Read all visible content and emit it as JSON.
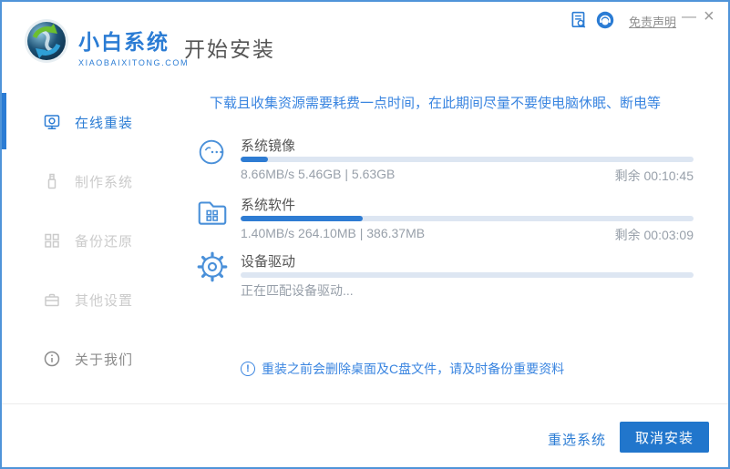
{
  "titlebar": {
    "brand": "小白系统",
    "brand_sub": "XIAOBAIXITONG.COM",
    "page_title": "开始安装",
    "disclaimer_label": "免责声明",
    "minimize_glyph": "—",
    "close_glyph": "×",
    "report_icon": "document-search-icon",
    "service_icon": "customer-service-icon"
  },
  "sidebar": {
    "items": [
      {
        "label": "在线重装",
        "icon": "online-reinstall-icon",
        "active": true
      },
      {
        "label": "制作系统",
        "icon": "usb-make-system-icon",
        "active": false
      },
      {
        "label": "备份还原",
        "icon": "backup-restore-icon",
        "active": false
      },
      {
        "label": "其他设置",
        "icon": "other-settings-icon",
        "active": false
      },
      {
        "label": "关于我们",
        "icon": "about-us-icon",
        "active": false
      }
    ]
  },
  "main": {
    "notice": "下载且收集资源需要耗费一点时间，在此期间尽量不要使电脑休眠、断电等",
    "tasks": [
      {
        "icon": "face-icon",
        "title": "系统镜像",
        "percent": 6,
        "stats": "8.66MB/s 5.46GB | 5.63GB",
        "remaining": "剩余 00:10:45"
      },
      {
        "icon": "folder-icon",
        "title": "系统软件",
        "percent": 27,
        "stats": "1.40MB/s 264.10MB | 386.37MB",
        "remaining": "剩余 00:03:09"
      },
      {
        "icon": "gear-icon",
        "title": "设备驱动",
        "percent": 0,
        "stats": "正在匹配设备驱动...",
        "remaining": ""
      }
    ],
    "warning_note": "重装之前会删除桌面及C盘文件，请及时备份重要资料"
  },
  "footer": {
    "reselect_label": "重选系统",
    "cancel_label": "取消安装"
  },
  "colors": {
    "accent": "#2b7cd4",
    "button_blue": "#2176cc",
    "progress_fill": "#2e7cd3",
    "progress_track": "#dde6f2",
    "notice_blue": "#3a85e0",
    "inactive_gray": "#cbcbcb",
    "stats_gray": "#98a0aa",
    "window_border": "#4f94d9"
  }
}
